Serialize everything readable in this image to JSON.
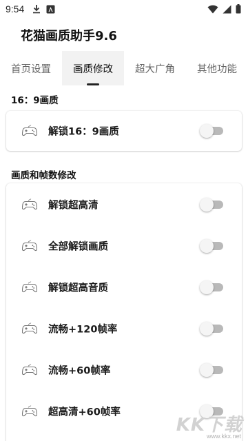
{
  "status_bar": {
    "time": "9:54",
    "left_icons": [
      "download-icon",
      "app-notification-icon"
    ],
    "right_icons": [
      "wifi-icon",
      "cellular-signal-icon",
      "battery-icon"
    ]
  },
  "app": {
    "title": "花猫画质助手9.6"
  },
  "tabs": [
    {
      "label": "首页设置",
      "active": false
    },
    {
      "label": "画质修改",
      "active": true
    },
    {
      "label": "超大广角",
      "active": false
    },
    {
      "label": "其他功能",
      "active": false
    }
  ],
  "sections": [
    {
      "title": "16：9画质",
      "items": [
        {
          "label": "解锁16：9画质",
          "icon": "gamepad-icon",
          "enabled": false
        }
      ]
    },
    {
      "title": "画质和帧数修改",
      "items": [
        {
          "label": "解锁超高清",
          "icon": "gamepad-icon",
          "enabled": false
        },
        {
          "label": "全部解锁画质",
          "icon": "gamepad-icon",
          "enabled": false
        },
        {
          "label": "解锁超高音质",
          "icon": "gamepad-icon",
          "enabled": false
        },
        {
          "label": "流畅+120帧率",
          "icon": "gamepad-icon",
          "enabled": false
        },
        {
          "label": "流畅+60帧率",
          "icon": "gamepad-icon",
          "enabled": false
        },
        {
          "label": "超高清+60帧率",
          "icon": "gamepad-icon",
          "enabled": false
        }
      ]
    }
  ],
  "watermark": {
    "text": "KK下载",
    "url": "www.kkx.net"
  },
  "colors": {
    "switch_track_off": "#b9b9b9",
    "active_tab_bg": "#f2f2f2",
    "text_primary": "#111111"
  }
}
